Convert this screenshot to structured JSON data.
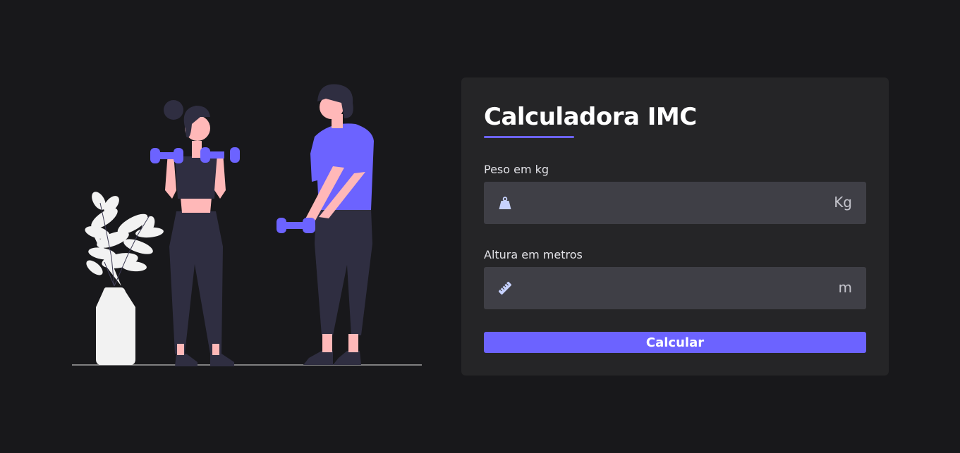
{
  "form": {
    "title": "Calculadora IMC",
    "weight": {
      "label": "Peso em kg",
      "value": "",
      "unit": "Kg",
      "icon": "weight-icon"
    },
    "height": {
      "label": "Altura em metros",
      "value": "",
      "unit": "m",
      "icon": "ruler-icon"
    },
    "submit_label": "Calcular"
  },
  "colors": {
    "background": "#18181b",
    "card": "#252527",
    "input": "#3f3f46",
    "accent": "#6c63ff"
  }
}
